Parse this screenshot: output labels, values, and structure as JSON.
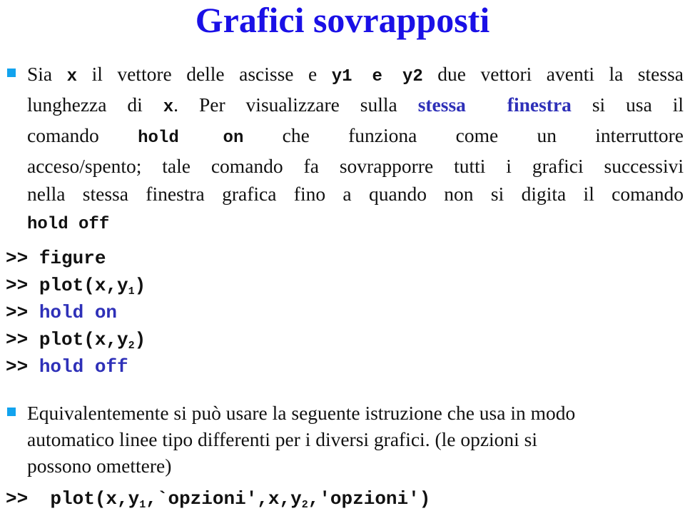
{
  "slide": {
    "title": "Grafici sovrapposti",
    "colors": {
      "title": "#1a10e6",
      "bullet": "#12a3ee",
      "highlight": "#2e30b8",
      "text": "#111111",
      "background": "#ffffff"
    }
  },
  "bullet1": {
    "icon": "square-bullet-icon",
    "line1": {
      "t1": "Sia ",
      "c1": "x",
      "t2": " il vettore delle ascisse e ",
      "c2": "y1 e y2",
      "t3": " due vettori aventi la stessa"
    },
    "line2": {
      "t1": "lunghezza di ",
      "c1": "x",
      "t2": ". Per visualizzare sulla ",
      "h1": "stessa  finestra",
      "t3": " si usa il"
    },
    "line3": {
      "t1": "comando ",
      "c1": "hold on",
      "t2": " che funziona come un interruttore"
    },
    "line4": "acceso/spento; tale comando fa sovrapporre tutti i grafici successivi",
    "line5": "nella stessa finestra grafica fino a quando non si digita il comando",
    "line6": {
      "c1": "hold off"
    }
  },
  "code_block": {
    "lines": [
      {
        "prompt": ">> ",
        "cmd": "figure",
        "blue": false
      },
      {
        "prompt": ">> ",
        "cmd_pre": "plot(x,y",
        "sub": "1",
        "cmd_post": ")",
        "blue": false
      },
      {
        "prompt": ">> ",
        "cmd": "hold on",
        "blue": true
      },
      {
        "prompt": ">> ",
        "cmd_pre": "plot(x,y",
        "sub": "2",
        "cmd_post": ")",
        "blue": false
      },
      {
        "prompt": ">> ",
        "cmd": "hold off",
        "blue": true
      }
    ]
  },
  "bullet2": {
    "icon": "square-bullet-icon",
    "line1": "Equivalentemente si può usare la seguente istruzione che usa in modo",
    "line2": "automatico linee tipo differenti per i diversi grafici. (le opzioni si",
    "line3": "possono omettere)"
  },
  "final_code": {
    "prompt": ">>  ",
    "p1": "plot(x,y",
    "sub1": "1",
    "p2": ",`opzioni',x,y",
    "sub2": "2",
    "p3": ",'opzioni')"
  }
}
